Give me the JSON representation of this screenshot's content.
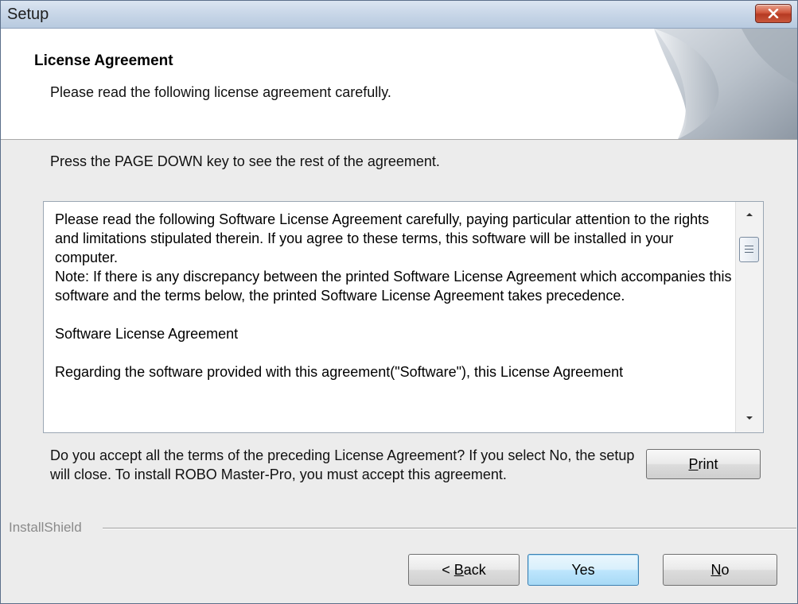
{
  "window": {
    "title": "Setup"
  },
  "header": {
    "title": "License Agreement",
    "subtitle": "Please read the following license agreement carefully."
  },
  "instruction": "Press the PAGE DOWN key to see the rest of the agreement.",
  "license": {
    "text": "Please read the following Software License Agreement carefully, paying particular attention to the rights and limitations stipulated therein. If you agree to these terms, this software will be installed in your computer.\nNote: If there is any discrepancy between the printed Software License Agreement which accompanies this software and the terms below, the printed Software License Agreement takes precedence.\n\nSoftware License Agreement\n\nRegarding the software provided with this agreement(\"Software\"), this License Agreement"
  },
  "question": "Do you accept all the terms of the preceding License Agreement?  If you select No,  the setup will close.  To install ROBO Master-Pro, you must accept this agreement.",
  "branding": "InstallShield",
  "buttons": {
    "print": {
      "label": "Print",
      "mnemonic": "P",
      "rest": "rint"
    },
    "back": {
      "label": "< Back",
      "prefix": "< ",
      "mnemonic": "B",
      "rest": "ack"
    },
    "yes": {
      "label": "Yes"
    },
    "no": {
      "label": "No",
      "mnemonic": "N",
      "rest": "o"
    }
  },
  "colors": {
    "close_button": "#c9573c",
    "default_button_border": "#3c7fb1",
    "titlebar": "#c9d7e8"
  },
  "icons": [
    "close-icon",
    "scroll-up-icon",
    "scroll-down-icon",
    "scroll-grip-icon",
    "page-curl-graphic"
  ]
}
